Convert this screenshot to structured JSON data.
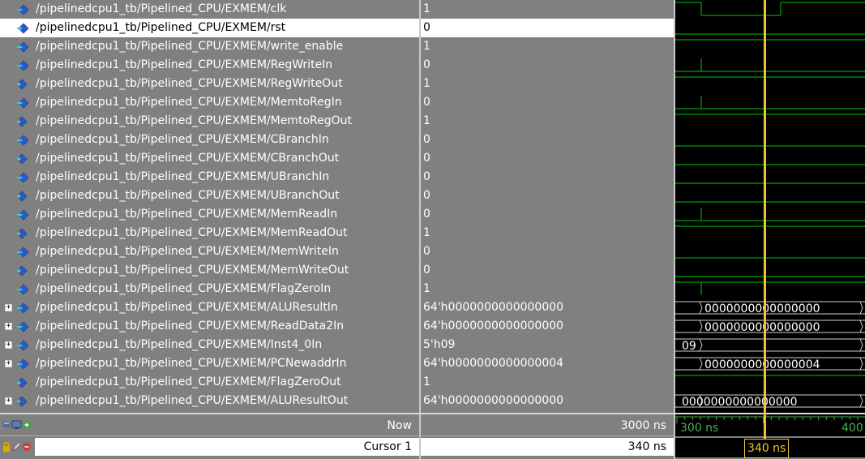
{
  "signals": [
    {
      "path": "/pipelinedcpu1_tb/Pipelined_CPU/EXMEM/clk",
      "value": "1",
      "kind": "in",
      "expandable": false
    },
    {
      "path": "/pipelinedcpu1_tb/Pipelined_CPU/EXMEM/rst",
      "value": "0",
      "kind": "in",
      "expandable": false,
      "selected": true
    },
    {
      "path": "/pipelinedcpu1_tb/Pipelined_CPU/EXMEM/write_enable",
      "value": "1",
      "kind": "in",
      "expandable": false
    },
    {
      "path": "/pipelinedcpu1_tb/Pipelined_CPU/EXMEM/RegWriteIn",
      "value": "0",
      "kind": "in",
      "expandable": false
    },
    {
      "path": "/pipelinedcpu1_tb/Pipelined_CPU/EXMEM/RegWriteOut",
      "value": "1",
      "kind": "out",
      "expandable": false
    },
    {
      "path": "/pipelinedcpu1_tb/Pipelined_CPU/EXMEM/MemtoRegIn",
      "value": "0",
      "kind": "in",
      "expandable": false
    },
    {
      "path": "/pipelinedcpu1_tb/Pipelined_CPU/EXMEM/MemtoRegOut",
      "value": "1",
      "kind": "out",
      "expandable": false
    },
    {
      "path": "/pipelinedcpu1_tb/Pipelined_CPU/EXMEM/CBranchIn",
      "value": "0",
      "kind": "in",
      "expandable": false
    },
    {
      "path": "/pipelinedcpu1_tb/Pipelined_CPU/EXMEM/CBranchOut",
      "value": "0",
      "kind": "out",
      "expandable": false
    },
    {
      "path": "/pipelinedcpu1_tb/Pipelined_CPU/EXMEM/UBranchIn",
      "value": "0",
      "kind": "in",
      "expandable": false
    },
    {
      "path": "/pipelinedcpu1_tb/Pipelined_CPU/EXMEM/UBranchOut",
      "value": "0",
      "kind": "out",
      "expandable": false
    },
    {
      "path": "/pipelinedcpu1_tb/Pipelined_CPU/EXMEM/MemReadIn",
      "value": "0",
      "kind": "in",
      "expandable": false
    },
    {
      "path": "/pipelinedcpu1_tb/Pipelined_CPU/EXMEM/MemReadOut",
      "value": "1",
      "kind": "out",
      "expandable": false
    },
    {
      "path": "/pipelinedcpu1_tb/Pipelined_CPU/EXMEM/MemWriteIn",
      "value": "0",
      "kind": "in",
      "expandable": false
    },
    {
      "path": "/pipelinedcpu1_tb/Pipelined_CPU/EXMEM/MemWriteOut",
      "value": "0",
      "kind": "out",
      "expandable": false
    },
    {
      "path": "/pipelinedcpu1_tb/Pipelined_CPU/EXMEM/FlagZeroIn",
      "value": "1",
      "kind": "in",
      "expandable": false
    },
    {
      "path": "/pipelinedcpu1_tb/Pipelined_CPU/EXMEM/ALUResultIn",
      "value": "64'h0000000000000000",
      "kind": "in",
      "expandable": true
    },
    {
      "path": "/pipelinedcpu1_tb/Pipelined_CPU/EXMEM/ReadData2In",
      "value": "64'h0000000000000000",
      "kind": "in",
      "expandable": true
    },
    {
      "path": "/pipelinedcpu1_tb/Pipelined_CPU/EXMEM/Inst4_0In",
      "value": "5'h09",
      "kind": "in",
      "expandable": true
    },
    {
      "path": "/pipelinedcpu1_tb/Pipelined_CPU/EXMEM/PCNewaddrIn",
      "value": "64'h0000000000000004",
      "kind": "in",
      "expandable": true
    },
    {
      "path": "/pipelinedcpu1_tb/Pipelined_CPU/EXMEM/FlagZeroOut",
      "value": "1",
      "kind": "out",
      "expandable": false
    },
    {
      "path": "/pipelinedcpu1_tb/Pipelined_CPU/EXMEM/ALUResultOut",
      "value": "64'h0000000000000000",
      "kind": "out",
      "expandable": true
    }
  ],
  "waveform_labels": {
    "ALUResultIn": "0000000000000000",
    "ReadData2In": "0000000000000000",
    "Inst4_0In": "09",
    "PCNewaddrIn": "0000000000000004",
    "ALUResultOut": "0000000000000000"
  },
  "footer": {
    "now_label": "Now",
    "now_value": "3000 ns",
    "cursor_label": "Cursor 1",
    "cursor_value": "340 ns"
  },
  "timeline": {
    "left_tick": "300 ns",
    "right_tick": "400",
    "cursor_time": "340 ns"
  },
  "colors": {
    "wave_green": "#00c800",
    "cursor_yellow": "#f1c232",
    "icon_blue": "#2a5cc8",
    "panel_gray": "#808080"
  }
}
